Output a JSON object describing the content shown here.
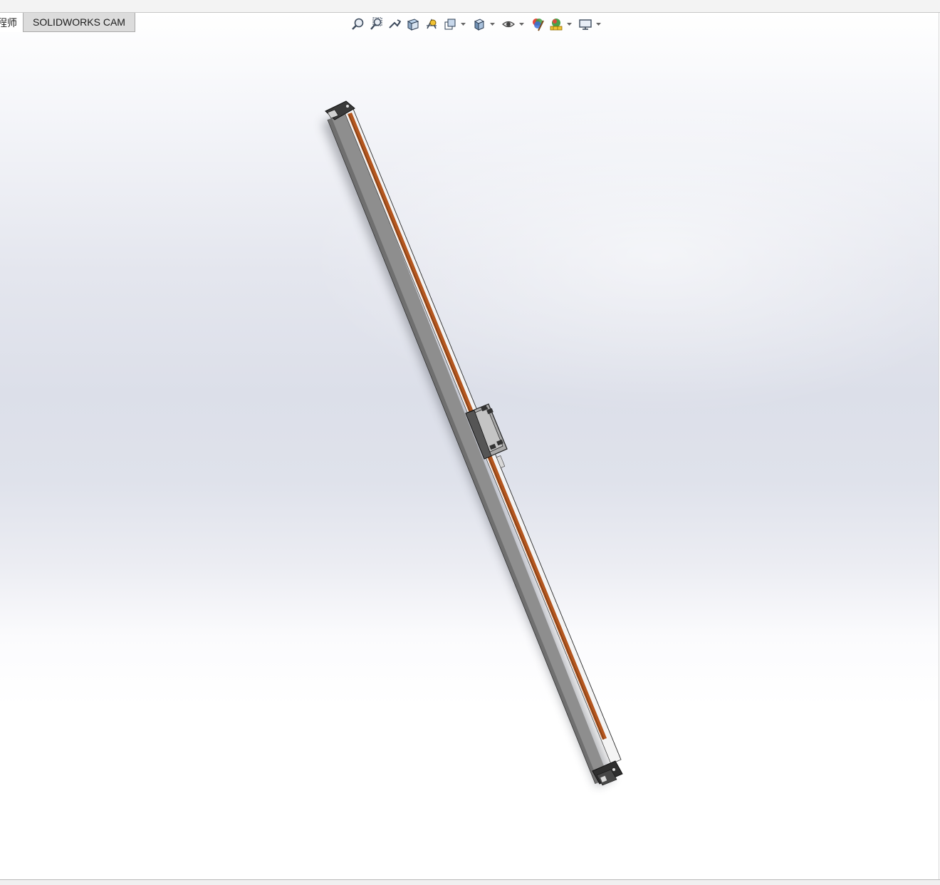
{
  "tabs": [
    {
      "label": "程师",
      "active": false
    },
    {
      "label": "SOLIDWORKS CAM",
      "active": true
    }
  ],
  "toolbar": {
    "icons": [
      "zoom-to-fit-icon",
      "zoom-to-area-icon",
      "previous-view-icon",
      "section-view-icon",
      "dynamic-annotation-views-icon",
      "view-orientation-icon",
      "display-style-icon",
      "hide-show-items-icon",
      "edit-appearance-icon",
      "apply-scene-icon",
      "view-settings-icon"
    ]
  },
  "colors": {
    "rail_gray": "#8c8c8c",
    "rail_dark": "#5a5a5a",
    "belt_orange": "#b4561e",
    "carriage": "#a9a9a9",
    "tab_active_bg": "#dcdcdc"
  }
}
